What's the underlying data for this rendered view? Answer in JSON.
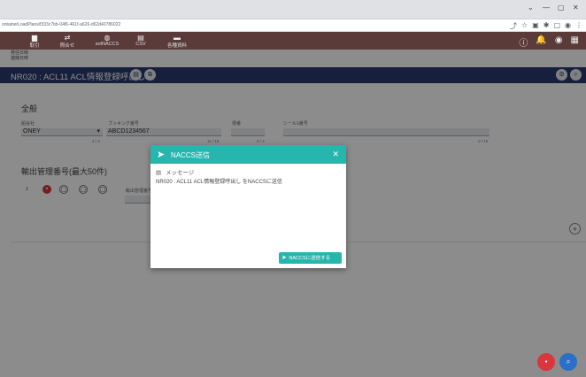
{
  "browser": {
    "url": "ontainerLoadPlans/f333c7bb-04f6-461f-a626-d62d40786022",
    "window_controls": [
      "⌄",
      "—",
      "▢",
      "✕"
    ],
    "addr_icons": [
      "⤴",
      "☆",
      "▣",
      "✱",
      "▢",
      "◉",
      "⋮"
    ]
  },
  "toolbar": {
    "items": [
      {
        "label": "取引",
        "icon": "building-icon"
      },
      {
        "label": "照合せ",
        "icon": "link-icon"
      },
      {
        "label": "sotNACCS",
        "icon": "globe-icon"
      },
      {
        "label": "CSV",
        "icon": "file-icon"
      },
      {
        "label": "各種資料",
        "icon": "folder-icon"
      }
    ],
    "right_icons": [
      "ⓘ",
      "🔔",
      "◉",
      "▦"
    ]
  },
  "crumbs": [
    "発信日時",
    "連絡日時"
  ],
  "title": "NR020 : ACL11 ACL情報登録呼出し",
  "form": {
    "section1": "全般",
    "company_label": "船会社",
    "company_value": "ONEY",
    "company_count": "4 / 4",
    "booking_label": "ブッキング番号",
    "booking_value": "ABCD1234567",
    "booking_count": "11 / 16",
    "shipment_label": "便番",
    "shipment_count": "0 / 2",
    "seal_label": "シール1番号",
    "seal_count": "0 / 15",
    "section2": "輸出管理番号(最大50件)",
    "row_number": "1",
    "row_field_label": "輸出管理番号"
  },
  "modal": {
    "title": "NACCS送信",
    "close": "✕",
    "msg_header": "メッセージ",
    "msg_body": "NR020 : ACL11 ACL情報登録呼出し をNACCSに送信",
    "send_label": "NACCSに送信する"
  },
  "colors": {
    "toolbar": "#5b3a3a",
    "title_bar": "#283b6e",
    "modal_accent": "#27b6ad",
    "fab_red": "#d9363e",
    "fab_blue": "#2b6fc6"
  }
}
